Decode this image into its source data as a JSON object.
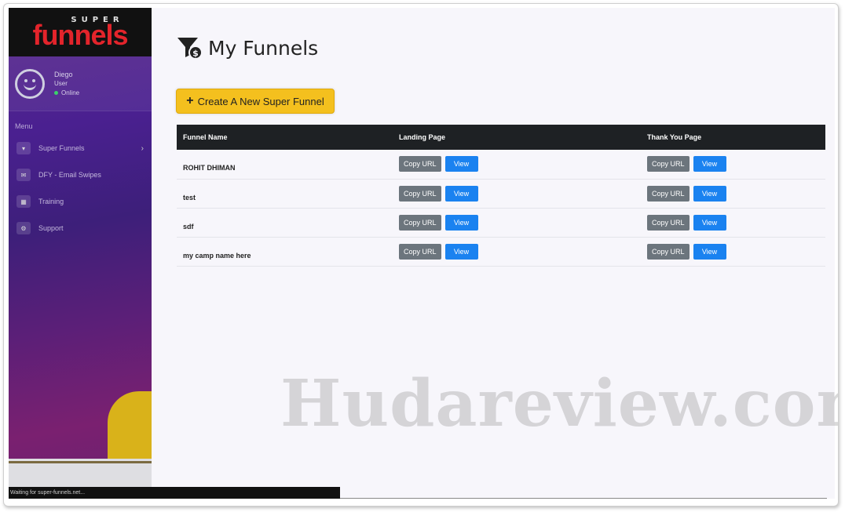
{
  "brand": {
    "super": "SUPER",
    "funnels": "funnels"
  },
  "user": {
    "name": "Diego",
    "role": "User",
    "status": "Online"
  },
  "menu": {
    "title": "Menu",
    "items": [
      {
        "label": "Super Funnels",
        "icon": "funnel-icon"
      },
      {
        "label": "DFY - Email Swipes",
        "icon": "email-icon"
      },
      {
        "label": "Training",
        "icon": "chart-icon"
      },
      {
        "label": "Support",
        "icon": "support-icon"
      }
    ]
  },
  "status_bar": "Waiting for super-funnels.net...",
  "page": {
    "title": "My Funnels",
    "create_button": "Create A New Super Funnel"
  },
  "table": {
    "headers": [
      "Funnel Name",
      "Landing Page",
      "Thank You Page"
    ],
    "copy_label": "Copy URL",
    "view_label": "View",
    "rows": [
      {
        "name": "ROHIT DHIMAN"
      },
      {
        "name": "test"
      },
      {
        "name": "sdf"
      },
      {
        "name": "my camp name here"
      }
    ]
  },
  "watermark": "Hudareview.com",
  "colors": {
    "accent": "#f4c01e",
    "view": "#1a82f0",
    "copy": "#6c757d",
    "brand_red": "#e3242b"
  }
}
